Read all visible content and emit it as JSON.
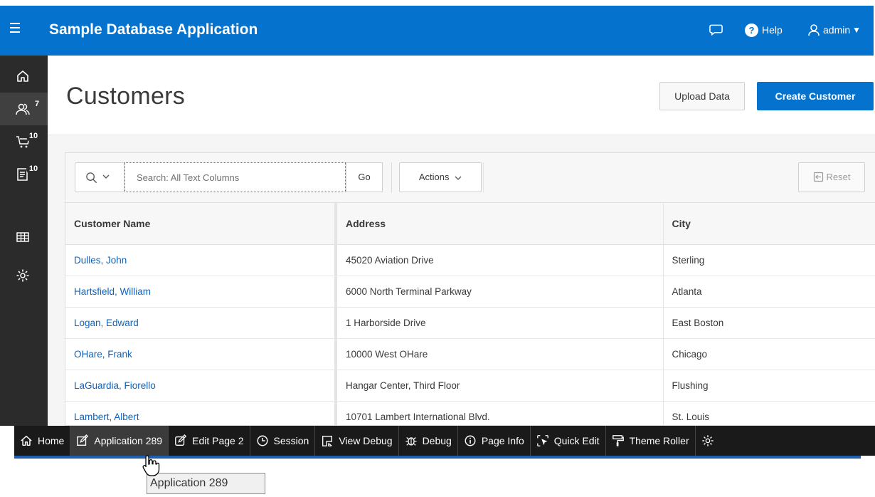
{
  "header": {
    "app_title": "Sample Database Application",
    "help_label": "Help",
    "user_label": "admin"
  },
  "sidebar": {
    "items": [
      {
        "icon": "home-icon",
        "badge": ""
      },
      {
        "icon": "users-icon",
        "badge": "7"
      },
      {
        "icon": "cart-icon",
        "badge": "10"
      },
      {
        "icon": "orders-icon",
        "badge": "10"
      },
      {
        "icon": "table-icon",
        "badge": ""
      },
      {
        "icon": "settings-icon",
        "badge": ""
      }
    ]
  },
  "page": {
    "title": "Customers",
    "upload_label": "Upload Data",
    "create_label": "Create Customer"
  },
  "report": {
    "search_placeholder": "Search: All Text Columns",
    "go_label": "Go",
    "actions_label": "Actions",
    "reset_label": "Reset",
    "columns": [
      "Customer Name",
      "Address",
      "City"
    ],
    "rows": [
      [
        "Dulles, John",
        "45020 Aviation Drive",
        "Sterling"
      ],
      [
        "Hartsfield, William",
        "6000 North Terminal Parkway",
        "Atlanta"
      ],
      [
        "Logan, Edward",
        "1 Harborside Drive",
        "East Boston"
      ],
      [
        "OHare, Frank",
        "10000 West OHare",
        "Chicago"
      ],
      [
        "LaGuardia, Fiorello",
        "Hangar Center, Third Floor",
        "Flushing"
      ],
      [
        "Lambert, Albert",
        "10701 Lambert International Blvd.",
        "St. Louis"
      ]
    ]
  },
  "devbar": {
    "items": [
      {
        "label": "Home",
        "icon": "home-icon"
      },
      {
        "label": "Application 289",
        "icon": "edit-app-icon"
      },
      {
        "label": "Edit Page 2",
        "icon": "edit-page-icon"
      },
      {
        "label": "Session",
        "icon": "clock-icon"
      },
      {
        "label": "View Debug",
        "icon": "view-debug-icon"
      },
      {
        "label": "Debug",
        "icon": "bug-icon"
      },
      {
        "label": "Page Info",
        "icon": "info-icon"
      },
      {
        "label": "Quick Edit",
        "icon": "quick-edit-icon"
      },
      {
        "label": "Theme Roller",
        "icon": "paint-roller-icon"
      }
    ]
  },
  "tooltip": {
    "text": "Application 289"
  },
  "colors": {
    "brand": "#0572ce",
    "link": "#0b64c0",
    "nav_bg": "#2b2b2b",
    "devbar_bg": "#1a1a1a"
  }
}
